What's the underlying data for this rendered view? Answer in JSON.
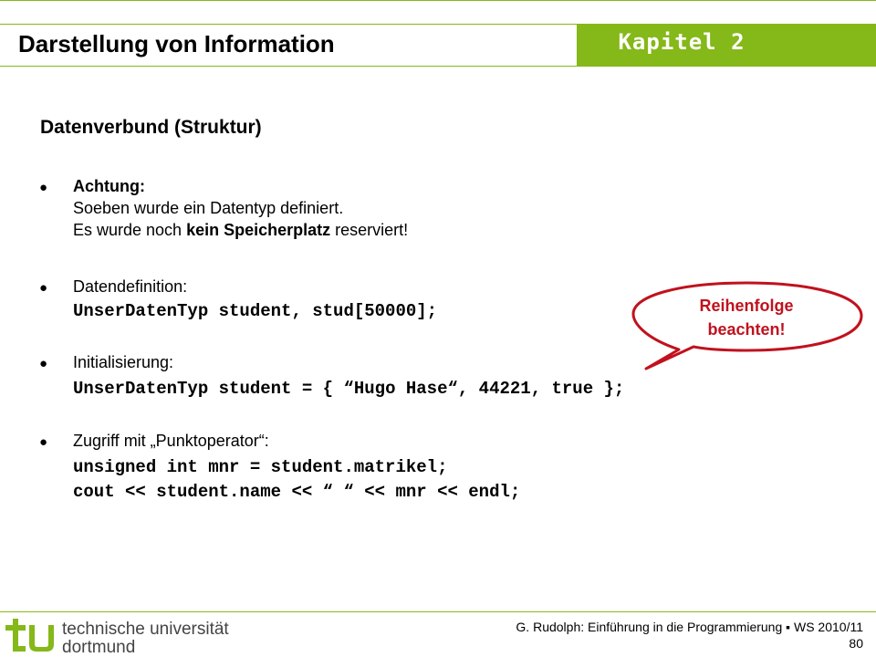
{
  "header": {
    "title": "Darstellung von Information",
    "chapter": "Kapitel 2"
  },
  "section": {
    "title": "Datenverbund (Struktur)"
  },
  "bullets": {
    "b1": {
      "marker": "●",
      "heading": "Achtung:",
      "line1": "Soeben wurde ein Datentyp definiert.",
      "line2_pre": "Es wurde noch ",
      "line2_bold": "kein Speicherplatz",
      "line2_post": " reserviert!"
    },
    "b2": {
      "marker": "●",
      "label": "Datendefinition:",
      "code": "UnserDatenTyp student, stud[50000];"
    },
    "b3": {
      "marker": "●",
      "label": "Initialisierung:",
      "code_a": "UnserDatenTyp",
      "code_b": "student = { “Hugo Hase“, 44221, true };"
    },
    "b4": {
      "marker": "●",
      "label": "Zugriff mit „Punktoperator“:",
      "code1": "unsigned int mnr = student.matrikel;",
      "code2": "cout << student.name << “ “ << mnr << endl;"
    }
  },
  "callout": {
    "line1": "Reihenfolge",
    "line2": "beachten!",
    "color": "#c0121e"
  },
  "footer": {
    "logo_text": "tu",
    "uni_line1": "technische universität",
    "uni_line2": "dortmund",
    "citation": "G. Rudolph: Einführung in die Programmierung ▪ WS 2010/11",
    "page": "80"
  },
  "colors": {
    "accent_green": "#85b819",
    "callout_red": "#c0121e"
  }
}
